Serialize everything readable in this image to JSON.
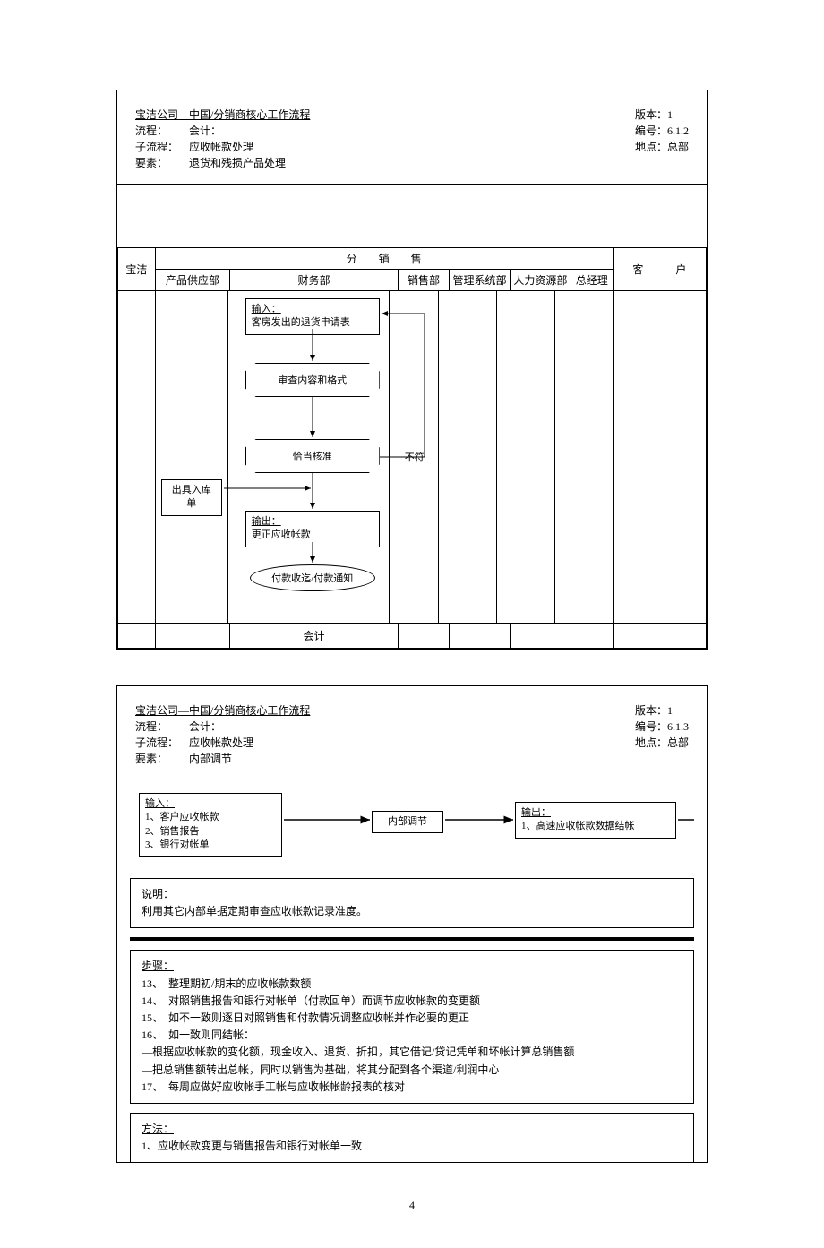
{
  "page_number": "4",
  "d1": {
    "header": {
      "title": "宝洁公司—中国/分销商核心工作流程",
      "row1_label": "流程：",
      "row1_value": "会计：",
      "row2_label": "子流程：",
      "row2_value": "应收帐款处理",
      "row3_label": "要素：",
      "row3_value": "退货和残损产品处理",
      "version": "版本：1",
      "number": "编号：6.1.2",
      "location": "地点：总部"
    },
    "lanes": {
      "baojie": "宝洁",
      "dist_title": "分　　销　　售",
      "supply": "产品供应部",
      "finance": "财务部",
      "sales": "销售部",
      "mis": "管理系统部",
      "hr": "人力资源部",
      "gm": "总经理",
      "customer": "客　　　户"
    },
    "flow": {
      "input_label": "输入：",
      "input_text": "客房发出的退货申请表",
      "review": "审查内容和格式",
      "approve": "恰当核准",
      "nomatch": "不符",
      "stockin": "出具入库单",
      "output_label": "输出：",
      "output_text": "更正应收帐款",
      "notice": "付款收迄/付款通知",
      "footer_role": "会计"
    }
  },
  "d2": {
    "header": {
      "title": "宝洁公司—中国/分销商核心工作流程",
      "row1_label": "流程：",
      "row1_value": "会计：",
      "row2_label": "子流程：",
      "row2_value": "应收帐款处理",
      "row3_label": "要素：",
      "row3_value": "内部调节",
      "version": "版本：1",
      "number": "编号：6.1.3",
      "location": "地点：总部"
    },
    "flow": {
      "input_label": "输入：",
      "input_1": "1、客户应收帐款",
      "input_2": "2、销售报告",
      "input_3": "3、银行对帐单",
      "center": "内部调节",
      "output_label": "输出：",
      "output_1": "1、高速应收帐款数据结帐"
    },
    "explain_label": "说明：",
    "explain_text": "利用其它内部单据定期审查应收帐款记录准度。",
    "steps_label": "步骤：",
    "steps": [
      "13、　整理期初/期末的应收帐款数额",
      "14、　对照销售报告和银行对帐单（付款回单）而调节应收帐款的变更额",
      "15、　如不一致则逐日对照销售和付款情况调整应收帐并作必要的更正",
      "16、　如一致则同结帐：",
      "—根据应收帐款的变化额，现金收入、退货、折扣，其它借记/贷记凭单和坏帐计算总销售额",
      "—把总销售额转出总帐，同时以销售为基础，将其分配到各个渠道/利润中心",
      "17、　每周应做好应收帐手工帐与应收帐帐龄报表的核对"
    ],
    "method_label": "方法：",
    "method_1": "1、应收帐款变更与销售报告和银行对帐单一致"
  }
}
